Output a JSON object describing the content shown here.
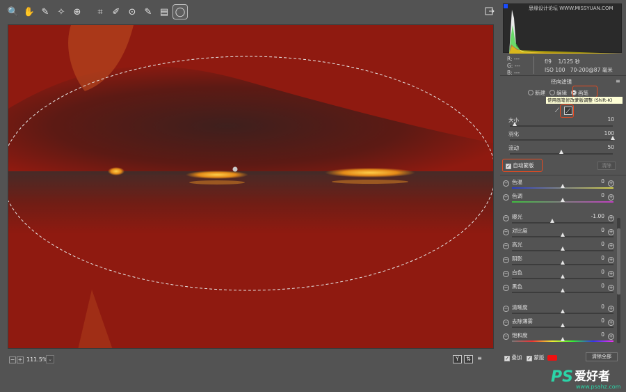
{
  "toolbar": {
    "tools": [
      {
        "name": "zoom-tool-icon",
        "glyph": "🔍"
      },
      {
        "name": "hand-tool-icon",
        "glyph": "✋"
      },
      {
        "name": "white-balance-icon",
        "glyph": "✎"
      },
      {
        "name": "color-sampler-icon",
        "glyph": "✧"
      },
      {
        "name": "targeted-adjust-icon",
        "glyph": "⊕"
      },
      {
        "name": "crop-icon",
        "glyph": "⌗"
      },
      {
        "name": "spot-removal-icon",
        "glyph": "✐"
      },
      {
        "name": "red-eye-icon",
        "glyph": "⊙"
      },
      {
        "name": "adjustment-brush-icon",
        "glyph": "✎"
      },
      {
        "name": "graduated-filter-icon",
        "glyph": "▤"
      },
      {
        "name": "radial-filter-icon",
        "glyph": "◯"
      }
    ]
  },
  "status": {
    "zoom": "111.5%",
    "zoom_minus": "−",
    "zoom_plus": "+",
    "dropdown": "⌄",
    "view_before_after": "Y",
    "view_toggle": "⇅",
    "view_settings": "≡"
  },
  "watermark_top": "思缘设计论坛 WWW.MISSYUAN.COM",
  "info": {
    "r": "R:  ---",
    "g": "G:  ---",
    "b": "B:  ---",
    "aperture": "f/9",
    "shutter": "1/125 秒",
    "iso": "ISO 100",
    "lens": "70-200@87 毫米"
  },
  "panel": {
    "title": "径向滤镜",
    "mode_new": "新建",
    "mode_edit": "编辑",
    "mode_brush": "画笔",
    "tooltip": "使用画笔修改蒙版调整 (Shift-K)",
    "auto_mask": "自动蒙版",
    "clear": "清除",
    "overlay": "叠加",
    "mask": "蒙版",
    "clear_all": "清除全部",
    "mask_color": "#ee1111"
  },
  "brush_sliders": [
    {
      "label": "大小",
      "value": "10",
      "pos": 0.05
    },
    {
      "label": "羽化",
      "value": "100",
      "pos": 1.0
    },
    {
      "label": "流动",
      "value": "50",
      "pos": 0.5
    }
  ],
  "adjustments": [
    {
      "label": "色温",
      "value": "0",
      "pos": 0.5,
      "track": "temp"
    },
    {
      "label": "色调",
      "value": "0",
      "pos": 0.5,
      "track": "tint"
    },
    {
      "label": "曝光",
      "value": "-1.00",
      "pos": 0.4,
      "track": "plain"
    },
    {
      "label": "对比度",
      "value": "0",
      "pos": 0.5,
      "track": "plain"
    },
    {
      "label": "高光",
      "value": "0",
      "pos": 0.5,
      "track": "plain"
    },
    {
      "label": "阴影",
      "value": "0",
      "pos": 0.5,
      "track": "plain"
    },
    {
      "label": "白色",
      "value": "0",
      "pos": 0.5,
      "track": "plain"
    },
    {
      "label": "黑色",
      "value": "0",
      "pos": 0.5,
      "track": "plain"
    },
    {
      "label": "清晰度",
      "value": "0",
      "pos": 0.5,
      "track": "plain"
    },
    {
      "label": "去除薄雾",
      "value": "0",
      "pos": 0.5,
      "track": "plain"
    },
    {
      "label": "饱和度",
      "value": "0",
      "pos": 0.5,
      "track": "sat"
    }
  ],
  "brand": {
    "logo_text": "PS",
    "cn": "爱好者",
    "url": "www.psahz.com"
  }
}
